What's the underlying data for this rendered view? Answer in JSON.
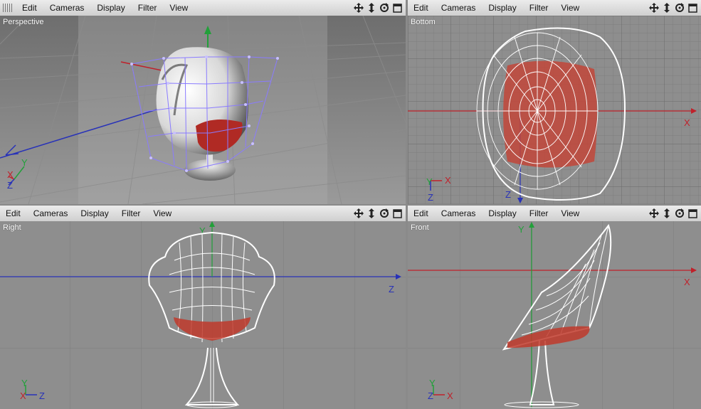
{
  "menu": {
    "items": [
      "Edit",
      "Cameras",
      "Display",
      "Filter",
      "View"
    ]
  },
  "viewports": [
    {
      "id": "perspective",
      "label": "Perspective"
    },
    {
      "id": "bottom",
      "label": "Bottom"
    },
    {
      "id": "right",
      "label": "Right"
    },
    {
      "id": "front",
      "label": "Front"
    }
  ],
  "axes": {
    "x": "X",
    "y": "Y",
    "z": "Z"
  },
  "colors": {
    "x_axis": "#c0202a",
    "y_axis": "#22a03a",
    "z_axis": "#2832b8",
    "wire": "#ffffff",
    "seat": "#c0392b",
    "cage": "#8a7bff"
  },
  "icons": [
    "move-view-icon",
    "dolly-view-icon",
    "rotate-view-icon",
    "maximize-view-icon"
  ]
}
